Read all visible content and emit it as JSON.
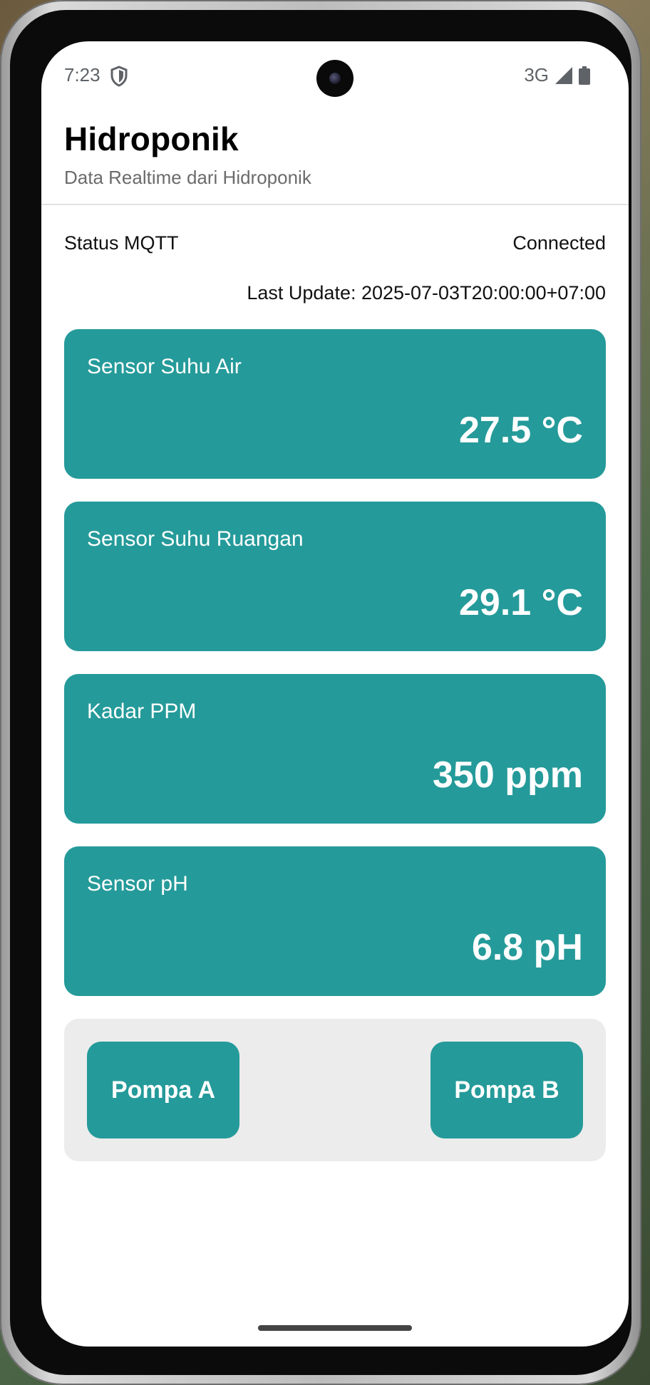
{
  "status_bar": {
    "time": "7:23",
    "network": "3G"
  },
  "app": {
    "title": "Hidroponik",
    "subtitle": "Data Realtime dari Hidroponik"
  },
  "mqtt": {
    "label": "Status MQTT",
    "value": "Connected"
  },
  "last_update": "Last Update: 2025-07-03T20:00:00+07:00",
  "sensors": [
    {
      "label": "Sensor Suhu Air",
      "value": "27.5 °C"
    },
    {
      "label": "Sensor Suhu Ruangan",
      "value": "29.1 °C"
    },
    {
      "label": "Kadar PPM",
      "value": "350 ppm"
    },
    {
      "label": "Sensor pH",
      "value": "6.8 pH"
    }
  ],
  "pumps": {
    "a_label": "Pompa A",
    "b_label": "Pompa B"
  },
  "colors": {
    "card": "#259a9a",
    "panel": "#ececec"
  },
  "icons": [
    "shield-icon",
    "camera-icon",
    "signal-icon",
    "battery-icon"
  ]
}
